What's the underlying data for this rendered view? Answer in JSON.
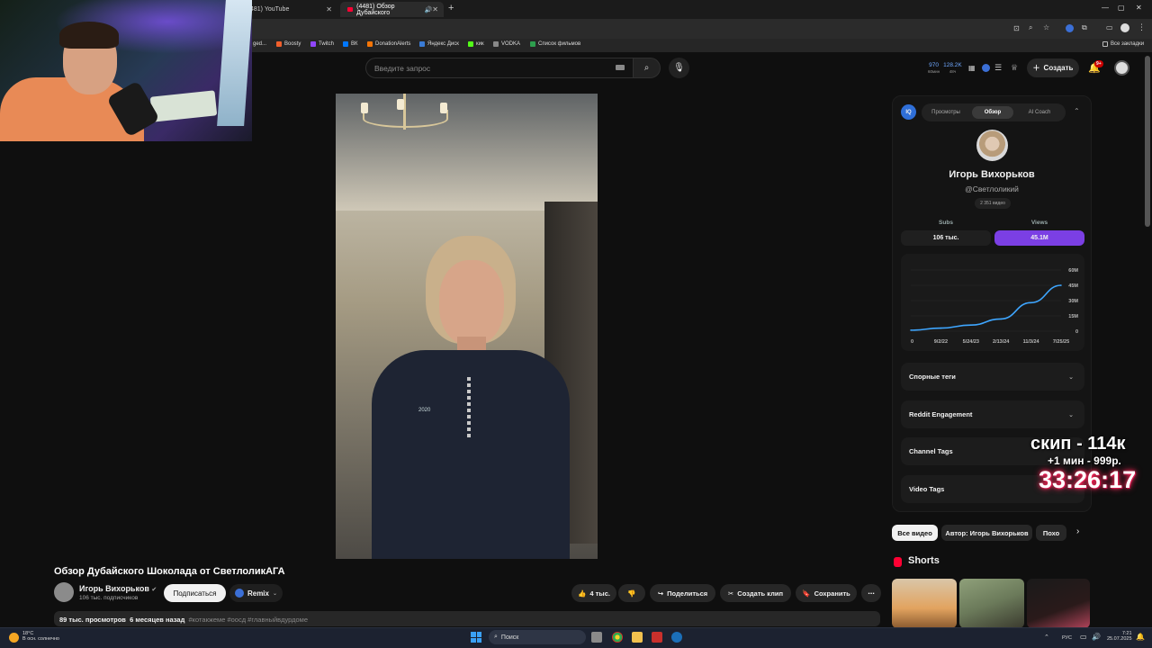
{
  "browser": {
    "tabs": [
      {
        "title": "481) YouTube"
      },
      {
        "title": "(4481) Обзор Дубайского"
      }
    ],
    "new_tab": "+",
    "bookmarks": [
      {
        "label": "ged...",
        "color": "#777777"
      },
      {
        "label": "Boosty",
        "color": "#f15f2c"
      },
      {
        "label": "Twitch",
        "color": "#9146ff"
      },
      {
        "label": "ВК",
        "color": "#0077ff"
      },
      {
        "label": "DonationAlerts",
        "color": "#f57507"
      },
      {
        "label": "Яндекс Диск",
        "color": "#3a7bd5"
      },
      {
        "label": "кик",
        "color": "#53fc18"
      },
      {
        "label": "VODKA",
        "color": "#888888"
      },
      {
        "label": "Список фильмов",
        "color": "#2e9e4e"
      }
    ],
    "all_bookmarks": "Все закладки"
  },
  "youtube": {
    "search_placeholder": "Введите запрос",
    "stats": {
      "a_top": "970",
      "a_bot": "60мин",
      "b_top": "128.2K",
      "b_bot": "48ч"
    },
    "create_label": "Создать",
    "notif_badge": "9+"
  },
  "video": {
    "title": "Обзор Дубайского Шоколада от СветлоликАГА",
    "channel_name": "Игорь Вихорьков",
    "channel_subs": "106 тыс. подписчиков",
    "subscribe": "Подписаться",
    "remix": "Remix",
    "likes": "4 тыс.",
    "share": "Поделиться",
    "clip": "Создать клип",
    "save": "Сохранить",
    "more": "⋯",
    "views": "89 тыс. просмотров",
    "age": "6 месяцев назад",
    "hashtags": "#котакжеме #оосд #главныйвдурдоме",
    "shirt_text": "2020"
  },
  "panel": {
    "logo": "IQ",
    "tabs": [
      "Просмотры",
      "Обзор",
      "AI Coach"
    ],
    "active_tab": 1,
    "name": "Игорь Вихорьков",
    "handle": "@Светлоликий",
    "videos": "2 351 видео",
    "subs_label": "Subs",
    "views_label": "Views",
    "subs_value": "106 тыс.",
    "views_value": "45.1M",
    "accordions": [
      "Спорные теги",
      "Reddit Engagement",
      "Channel Tags",
      "Video Tags"
    ]
  },
  "chart_data": {
    "type": "line",
    "title": "",
    "x_ticks": [
      "0",
      "9/2/22",
      "5/24/23",
      "2/13/24",
      "11/3/24",
      "7/25/25"
    ],
    "y_ticks": [
      "0",
      "15M",
      "30M",
      "45M",
      "60M"
    ],
    "ylim": [
      0,
      60
    ],
    "x": [
      0,
      1,
      2,
      3,
      4,
      5
    ],
    "series": [
      {
        "values": [
          1,
          3,
          6,
          12,
          28,
          45
        ],
        "color": "#3ea6ff"
      }
    ],
    "grid": true,
    "legend": "none"
  },
  "overlay": {
    "line1": "скип - 114к",
    "line2": "+1 мин - 999р.",
    "timer": "33:26:17"
  },
  "chips": [
    "Все видео",
    "Автор: Игорь Вихорьков",
    "Похо"
  ],
  "shorts_label": "Shorts",
  "taskbar": {
    "weather_temp": "18°C",
    "weather_desc": "В осн. солнечно",
    "search": "Поиск",
    "lang": "РУС",
    "time": "7:21",
    "date": "25.07.2025"
  }
}
